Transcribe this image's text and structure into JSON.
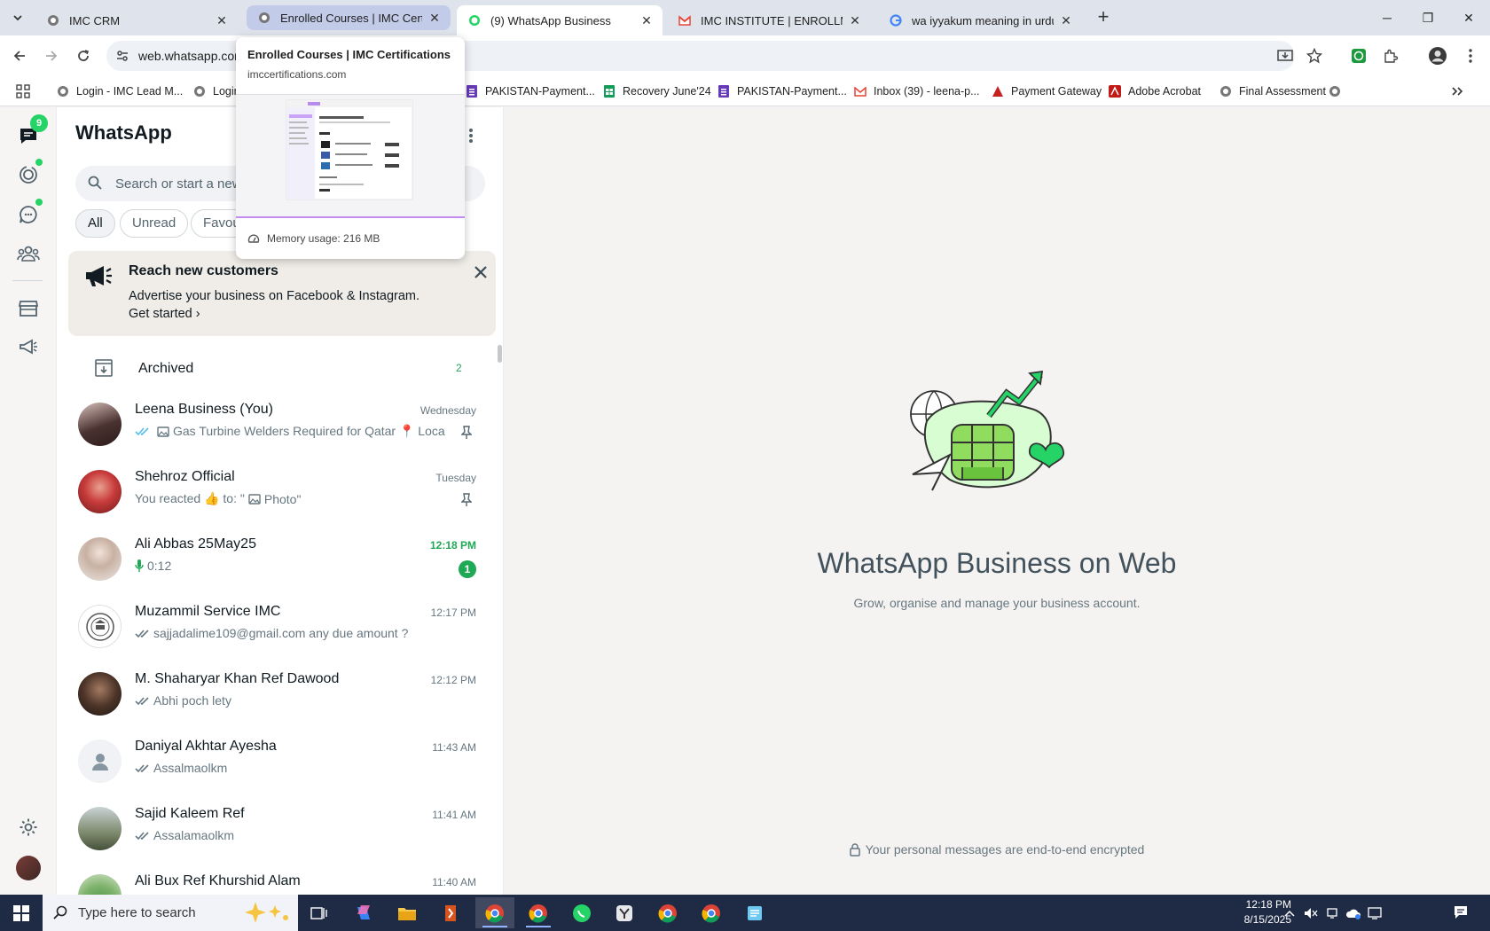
{
  "browser": {
    "tabs": [
      {
        "title": "IMC CRM"
      },
      {
        "title": "Enrolled Courses | IMC Certifications"
      },
      {
        "title": "(9) WhatsApp Business"
      },
      {
        "title": "IMC INSTITUTE | ENROLLMENT"
      },
      {
        "title": "wa iyyakum meaning in urdu - Google Search"
      }
    ],
    "address": "web.whatsapp.com",
    "bookmarks": [
      {
        "label": "Login - IMC Lead M..."
      },
      {
        "label": "Login"
      },
      {
        "label": "PAKISTAN-Payment..."
      },
      {
        "label": "Recovery June'24"
      },
      {
        "label": "PAKISTAN-Payment..."
      },
      {
        "label": "Inbox (39) - leena-p..."
      },
      {
        "label": "Payment Gateway"
      },
      {
        "label": "Adobe Acrobat"
      },
      {
        "label": "Final Assessment"
      }
    ]
  },
  "hovercard": {
    "title": "Enrolled Courses | IMC Certifications",
    "url": "imccertifications.com",
    "memory": "Memory usage: 216 MB"
  },
  "whatsapp": {
    "rail": {
      "chats_badge": "9"
    },
    "title": "WhatsApp",
    "search_placeholder": "Search or start a new chat",
    "filters": [
      "All",
      "Unread",
      "Favourites"
    ],
    "promo": {
      "title": "Reach new customers",
      "desc": "Advertise your business on Facebook & Instagram.",
      "link": "Get started"
    },
    "archived": {
      "label": "Archived",
      "count": "2"
    },
    "chats": [
      {
        "name": "Leena Business (You)",
        "time": "Wednesday",
        "preview": "Gas Turbine Welders Required for Qatar 📍 Location: Qatar",
        "tick": true,
        "image": true,
        "pinned": true,
        "avatar": "photo"
      },
      {
        "name": "Shehroz Official",
        "time": "Tuesday",
        "preview_prefix": "You reacted 👍 to: \"",
        "preview": "Photo\"",
        "image": true,
        "pinned": true,
        "avatar": "photo-red"
      },
      {
        "name": "Ali Abbas 25May25",
        "time": "12:18 PM",
        "preview": "0:12",
        "mic": true,
        "unread": "1",
        "avatar": "photo-light"
      },
      {
        "name": "Muzammil Service IMC",
        "time": "12:17 PM",
        "preview": "sajjadalime109@gmail.com any due amount ?",
        "tick": true,
        "avatar": "logo"
      },
      {
        "name": "M. Shaharyar Khan Ref Dawood",
        "time": "12:12 PM",
        "preview": "Abhi poch lety",
        "tick": true,
        "avatar": "photo-dark"
      },
      {
        "name": "Daniyal Akhtar Ayesha",
        "time": "11:43 AM",
        "preview": "Assalmaolkm",
        "tick": true,
        "avatar": "default"
      },
      {
        "name": "Sajid Kaleem Ref",
        "time": "11:41 AM",
        "preview": "Assalamaolkm",
        "tick": true,
        "avatar": "photo-tree"
      },
      {
        "name": "Ali Bux Ref Khurshid Alam",
        "time": "11:40 AM",
        "preview": "",
        "avatar": "photo-green"
      }
    ],
    "main": {
      "title": "WhatsApp Business on Web",
      "subtitle": "Grow, organise and manage your business account.",
      "footer": "Your personal messages are end-to-end encrypted"
    }
  },
  "taskbar": {
    "search_placeholder": "Type here to search",
    "time": "12:18 PM",
    "date": "8/15/2025"
  },
  "colors": {
    "accent": "#25d366",
    "unread_green": "#1fa855",
    "tick_blue": "#53bdeb"
  }
}
